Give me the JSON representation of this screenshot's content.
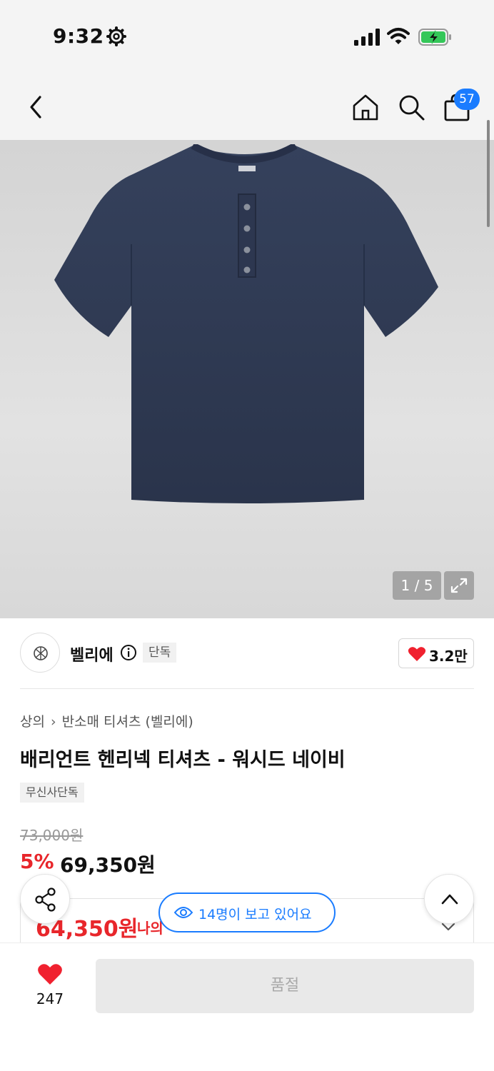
{
  "status_bar": {
    "time": "9:32"
  },
  "nav": {
    "cart_count": "57"
  },
  "gallery": {
    "counter": "1 / 5"
  },
  "brand": {
    "name": "벨리에",
    "exclusive_tag": "단독",
    "like_count": "3.2만"
  },
  "breadcrumb": {
    "items": [
      "상의",
      "반소매 티셔츠 (벨리에)"
    ]
  },
  "product": {
    "title": "배리언트 헨리넥 티셔츠 - 워시드 네이비",
    "tag": "무신사단독"
  },
  "price": {
    "original": "73,000원",
    "discount_rate": "5%",
    "sale": "69,350원",
    "member_price": "64,350원",
    "member_label": "나의"
  },
  "viewers": {
    "text": "14명이 보고 있어요"
  },
  "bottom_bar": {
    "wish_count": "247",
    "buy_button": "품절"
  },
  "colors": {
    "accent_blue": "#1a7cff",
    "sale_red": "#e8262b",
    "heart_red": "#f0212f",
    "shirt_navy": "#2f3b54"
  }
}
